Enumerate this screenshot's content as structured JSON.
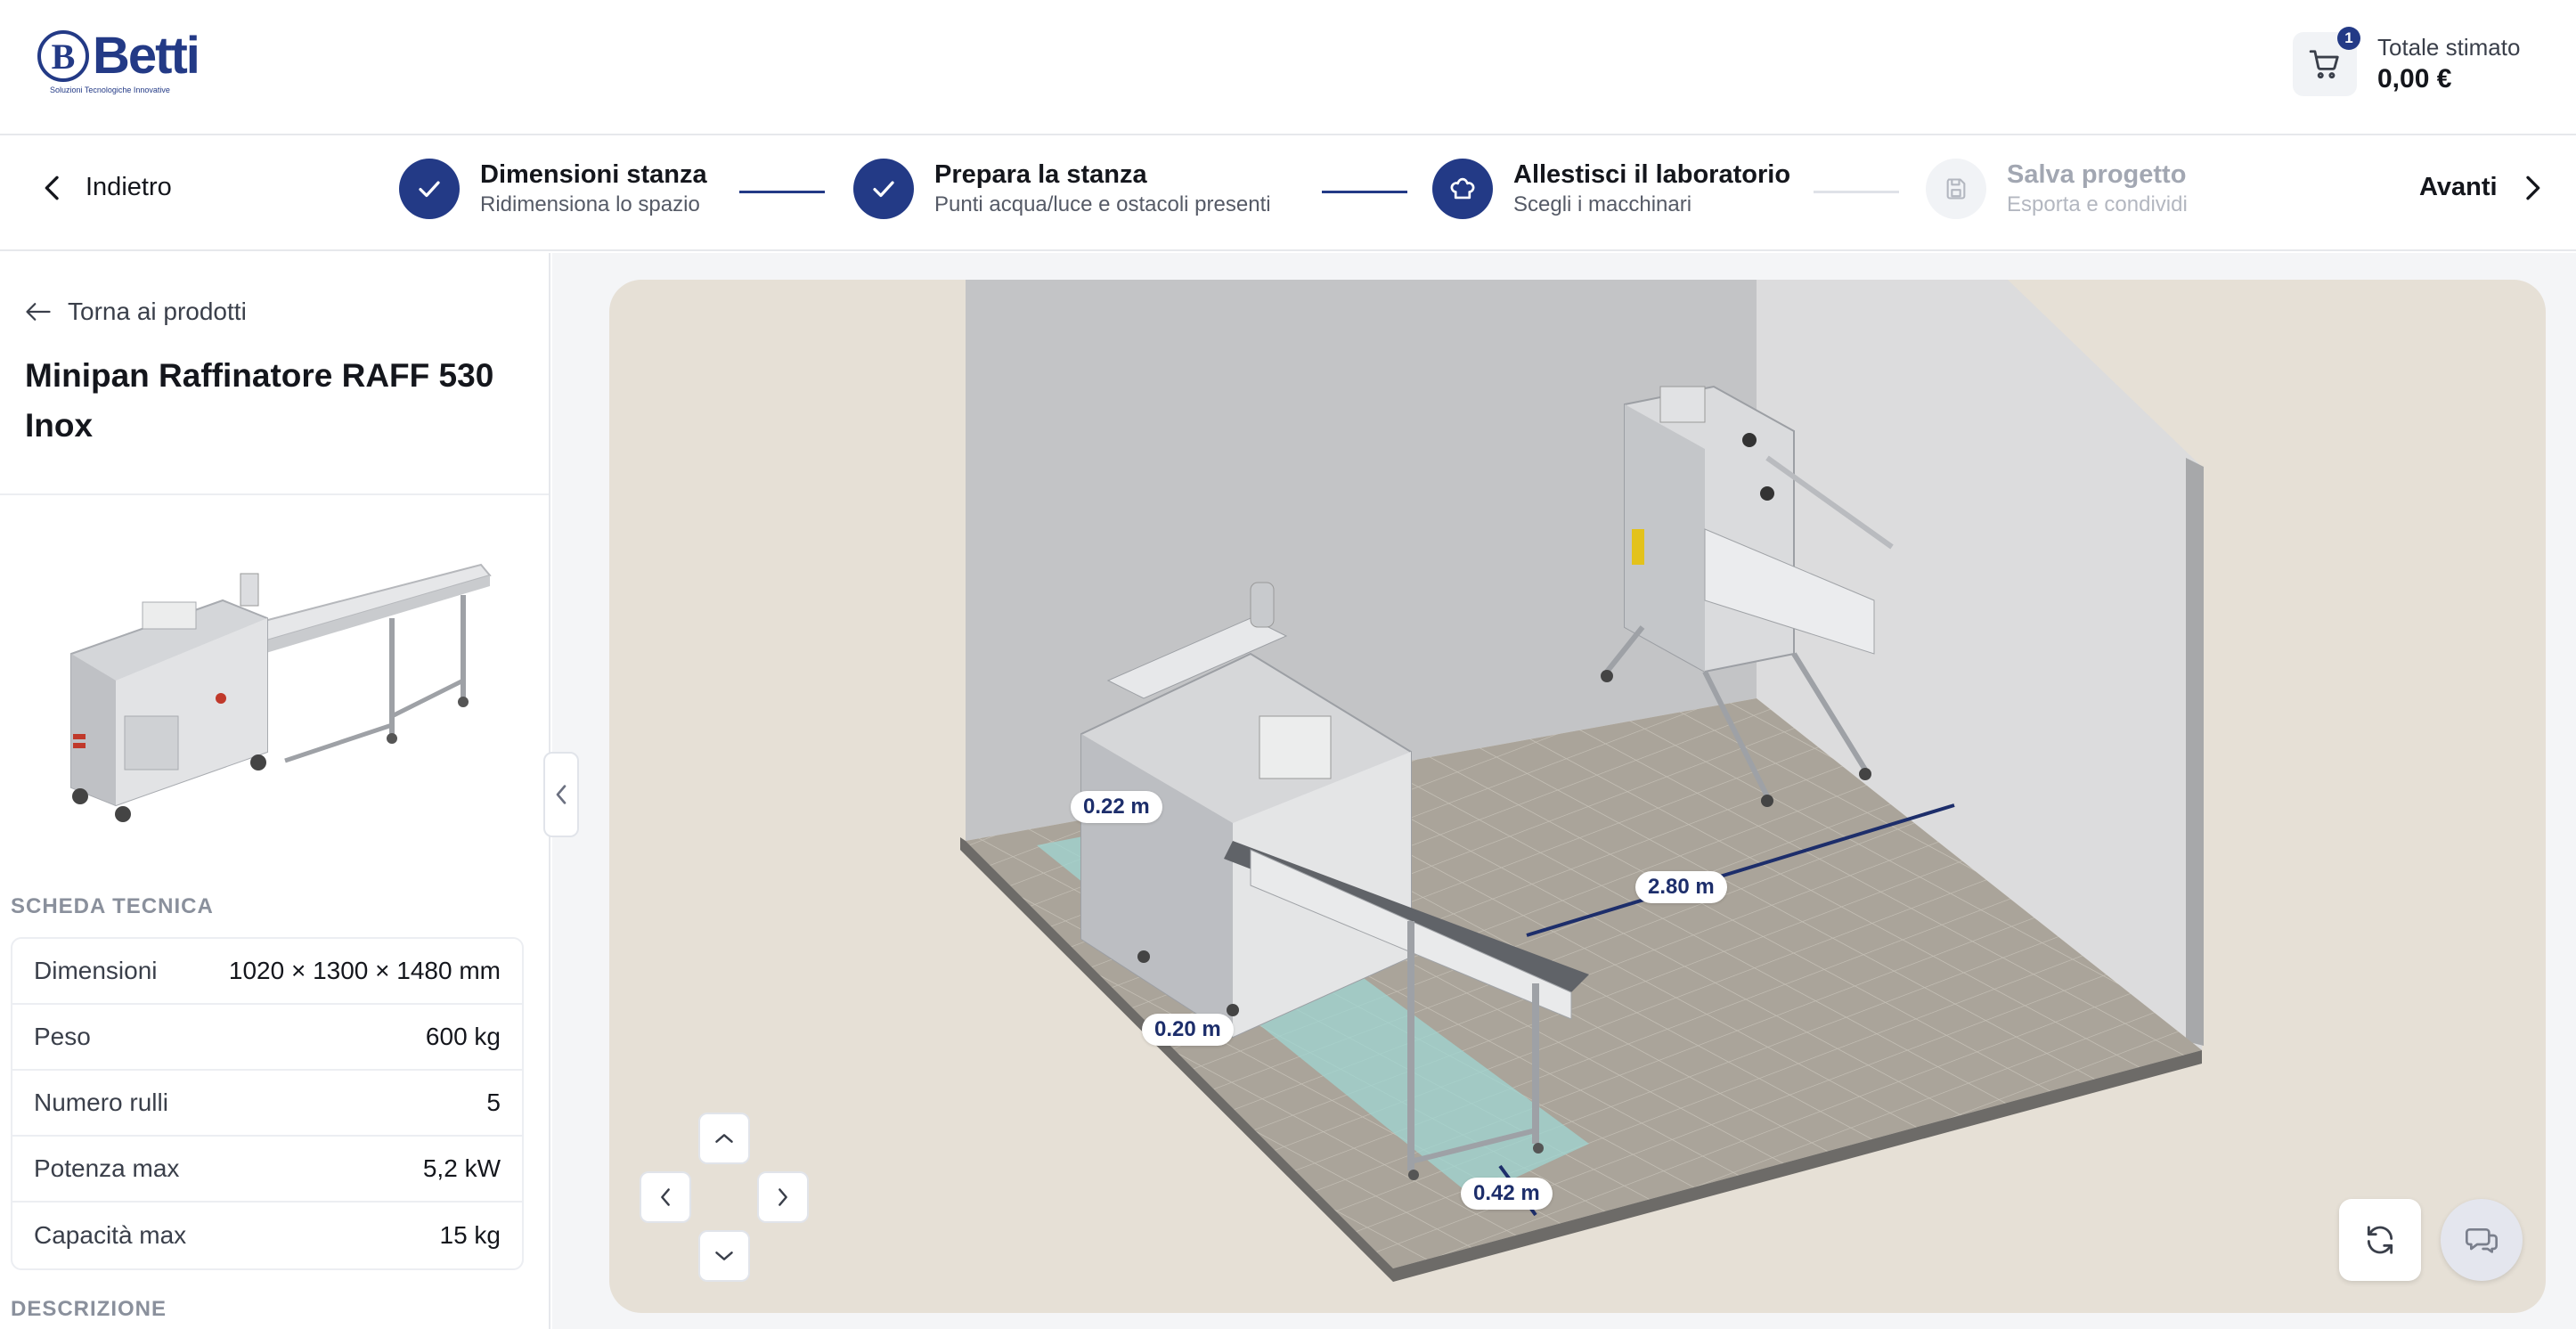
{
  "header": {
    "logo_text": "Betti",
    "logo_tagline": "Soluzioni Tecnologiche Innovative",
    "cart_count": "1",
    "total_label": "Totale stimato",
    "total_value": "0,00 €"
  },
  "stepper": {
    "back_label": "Indietro",
    "next_label": "Avanti",
    "steps": [
      {
        "title": "Dimensioni stanza",
        "subtitle": "Ridimensiona lo spazio",
        "state": "done"
      },
      {
        "title": "Prepara la stanza",
        "subtitle": "Punti acqua/luce e ostacoli presenti",
        "state": "done"
      },
      {
        "title": "Allestisci il laboratorio",
        "subtitle": "Scegli i macchinari",
        "state": "current"
      },
      {
        "title": "Salva progetto",
        "subtitle": "Esporta e condividi",
        "state": "future"
      }
    ]
  },
  "sidebar": {
    "back_label": "Torna ai prodotti",
    "product_title": "Minipan Raffinatore RAFF 530 Inox",
    "spec_heading": "SCHEDA TECNICA",
    "specs": [
      {
        "key": "Dimensioni",
        "value": "1020 × 1300 × 1480 mm"
      },
      {
        "key": "Peso",
        "value": "600 kg"
      },
      {
        "key": "Numero rulli",
        "value": "5"
      },
      {
        "key": "Potenza max",
        "value": "5,2 kW"
      },
      {
        "key": "Capacità max",
        "value": "15 kg"
      }
    ],
    "description_heading": "DESCRIZIONE"
  },
  "scene": {
    "dimensions": {
      "left_gap": "0.22 m",
      "room_width": "2.80 m",
      "front_gap": "0.20 m",
      "bottom_gap": "0.42 m"
    }
  },
  "colors": {
    "brand": "#233a86",
    "floor_tile": "#aaa49a",
    "wall": "#c3c4c6",
    "clearance_zone": "#9fd6d2"
  },
  "icons": {
    "cart": "cart-icon",
    "check": "check-icon",
    "chef_hat": "chef-hat-icon",
    "save": "save-icon",
    "reset": "refresh-icon",
    "chat": "chat-icon"
  }
}
